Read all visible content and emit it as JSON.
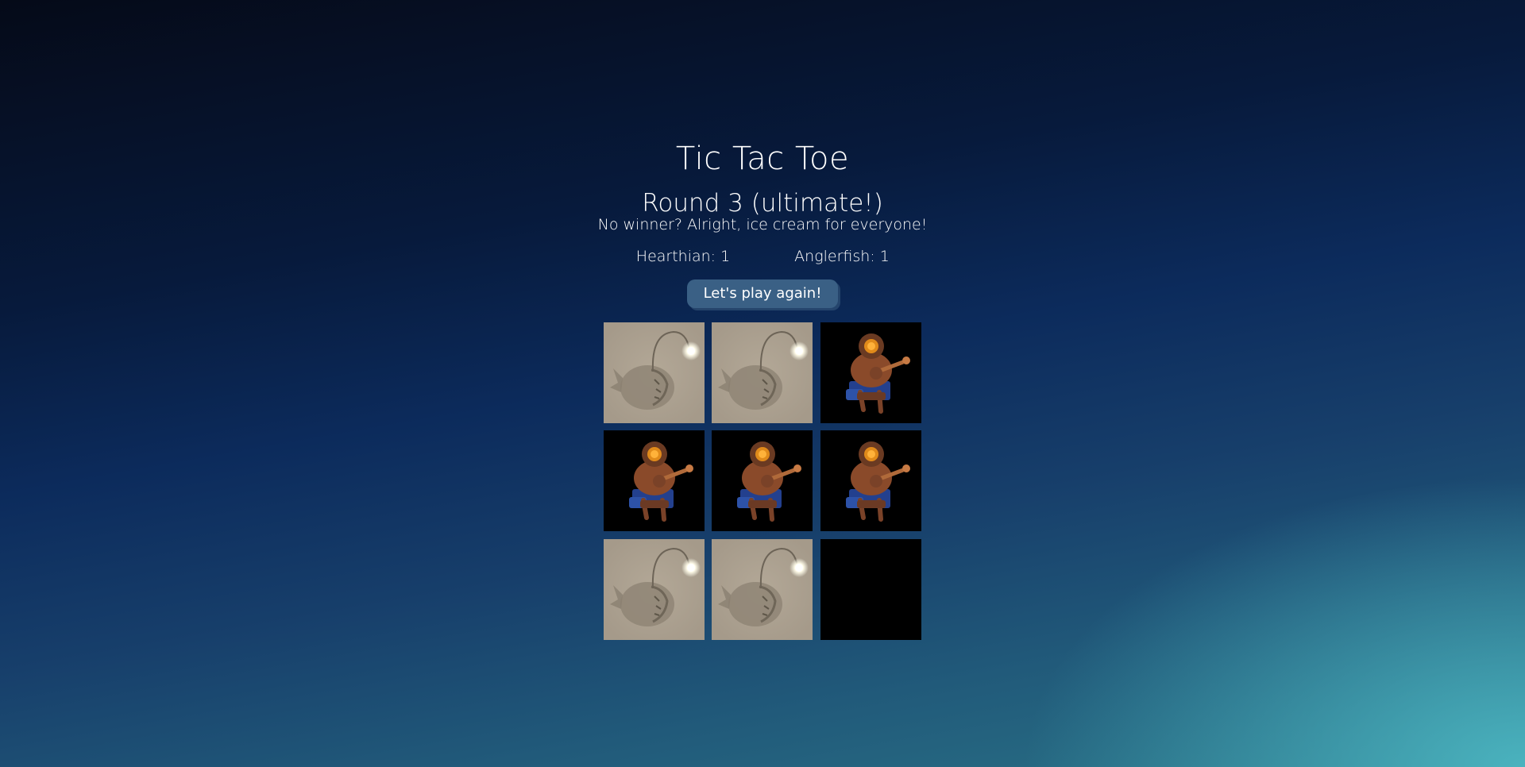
{
  "title": "Tic Tac Toe",
  "round_label": "Round 3 (ultimate!)",
  "status_message": "No winner? Alright, ice cream for everyone!",
  "scores": {
    "hearthian": "Hearthian: 1",
    "anglerfish": "Anglerfish: 1"
  },
  "play_again_label": "Let's play again!",
  "board": {
    "cells": [
      "anglerfish",
      "anglerfish",
      "hearthian",
      "hearthian",
      "hearthian",
      "hearthian",
      "anglerfish",
      "anglerfish",
      "empty"
    ]
  },
  "colors": {
    "button": "#3a6085",
    "anglerfish_tile": "#a59a8a",
    "hearthian_tile": "#000000",
    "empty_tile": "#000000"
  }
}
